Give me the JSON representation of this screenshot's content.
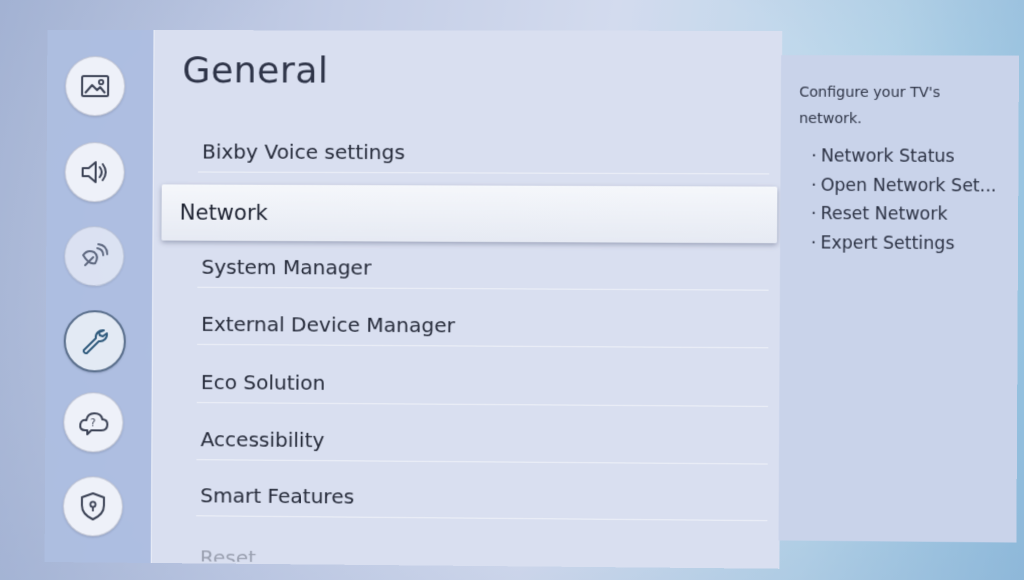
{
  "sidebar": {
    "icons": [
      {
        "name": "picture-icon"
      },
      {
        "name": "sound-icon"
      },
      {
        "name": "broadcasting-icon"
      },
      {
        "name": "general-wrench-icon",
        "selected": true
      },
      {
        "name": "support-icon"
      },
      {
        "name": "privacy-shield-icon"
      }
    ]
  },
  "main": {
    "title": "General",
    "items": [
      {
        "label": "Bixby Voice settings"
      },
      {
        "label": "Network",
        "focused": true
      },
      {
        "label": "System Manager"
      },
      {
        "label": "External Device Manager"
      },
      {
        "label": "Eco Solution"
      },
      {
        "label": "Accessibility"
      },
      {
        "label": "Smart Features"
      },
      {
        "label": "Reset"
      }
    ]
  },
  "info": {
    "description": "Configure your TV's network.",
    "items": [
      {
        "label": "Network Status"
      },
      {
        "label": "Open Network Set..."
      },
      {
        "label": "Reset Network"
      },
      {
        "label": "Expert Settings"
      }
    ]
  },
  "colors": {
    "menu_bg": "#d9dff0",
    "rail_bg": "#adbee0",
    "info_bg": "#c9d3ea",
    "focus_bg": "#f5f7fb",
    "text": "#262b3a"
  }
}
